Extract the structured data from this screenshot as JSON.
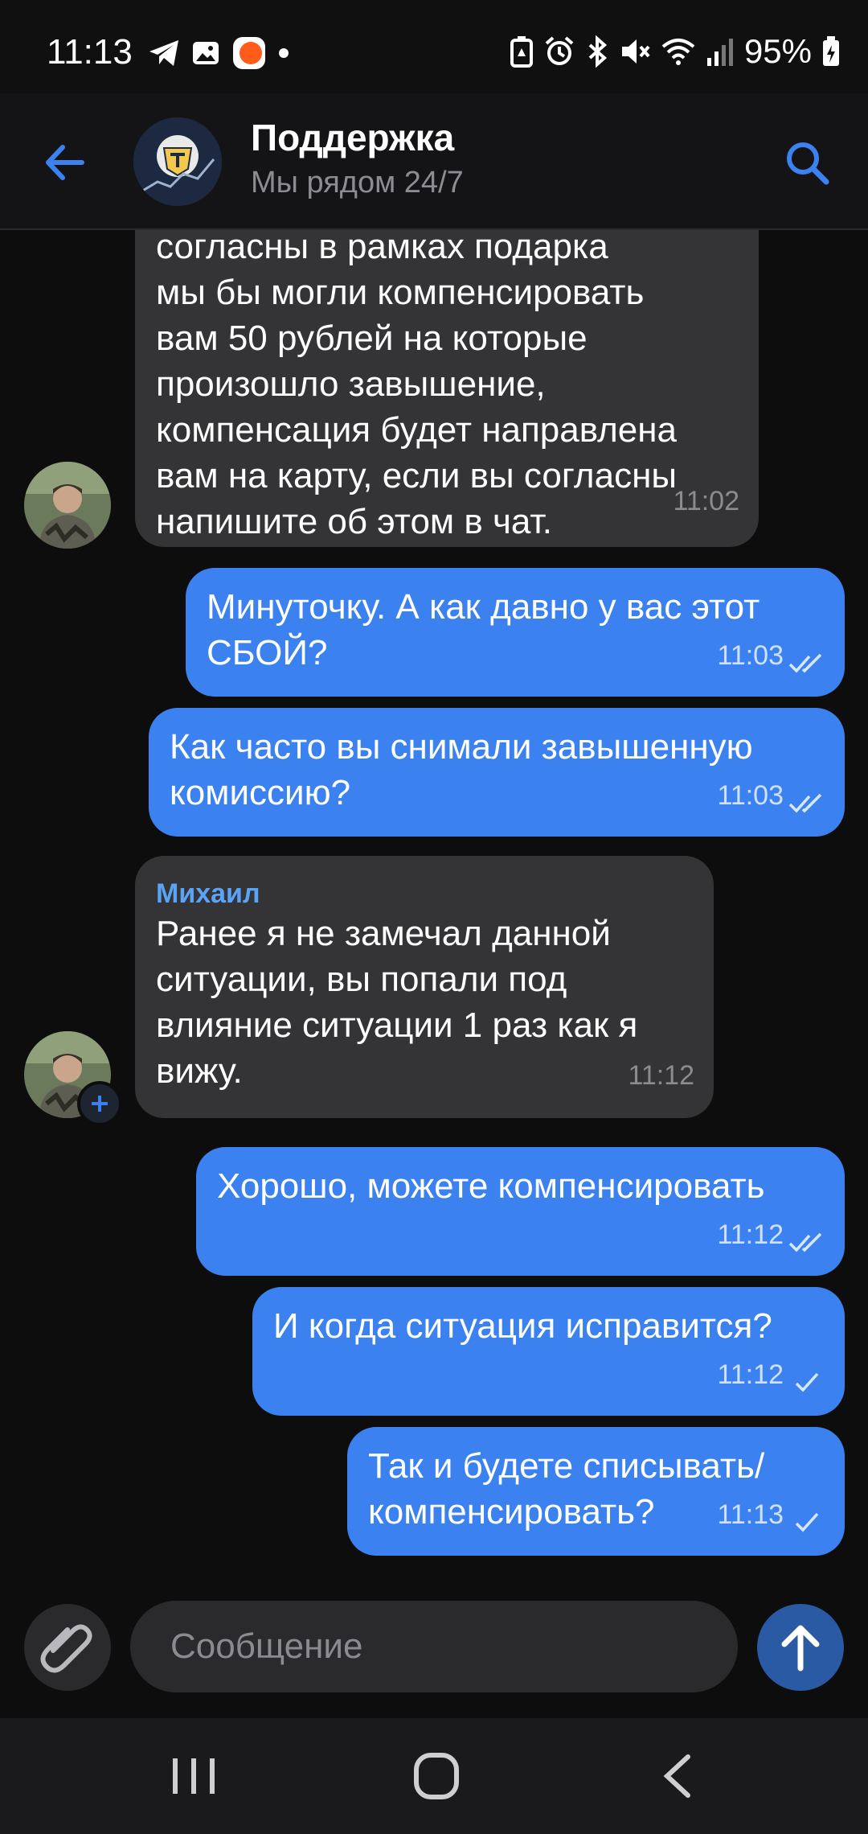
{
  "status_bar": {
    "time": "11:13",
    "battery": "95%",
    "left_icons": [
      "telegram-icon",
      "gallery-icon",
      "app-notification-icon",
      "dot-icon"
    ],
    "right_icons": [
      "battery-saver-icon",
      "alarm-icon",
      "bluetooth-icon",
      "mute-icon",
      "wifi-icon",
      "signal-icon",
      "battery-icon"
    ]
  },
  "header": {
    "title": "Поддержка",
    "subtitle": "Мы рядом 24/7"
  },
  "messages": [
    {
      "dir": "in",
      "text": "согласны в рамках подарка\nмы бы могли компенсировать\nвам 50 рублей на которые\nпроизошло завышение,\nкомпенсация будет направлена\nвам на карту, если вы согласны\nнапишите об этом в чат.",
      "time": "11:02"
    },
    {
      "dir": "out",
      "text": "Минуточку. А как давно у вас этот\nСБОЙ?",
      "time": "11:03",
      "status": "read"
    },
    {
      "dir": "out",
      "text": "Как часто вы снимали завышенную\nкомиссию?",
      "time": "11:03",
      "status": "read"
    },
    {
      "dir": "in",
      "sender": "Михаил",
      "text": "Ранее я не замечал данной\nситуации, вы попали под\nвлияние ситуации 1 раз как я\nвижу.",
      "time": "11:12"
    },
    {
      "dir": "out",
      "text": "Хорошо, можете компенсировать",
      "time": "11:12",
      "status": "read"
    },
    {
      "dir": "out",
      "text": "И когда ситуация исправится?",
      "time": "11:12",
      "status": "sent"
    },
    {
      "dir": "out",
      "text": "Так и будете списывать/\nкомпенсировать?",
      "time": "11:13",
      "status": "sent"
    }
  ],
  "composer": {
    "placeholder": "Сообщение"
  },
  "colors": {
    "outgoing_bubble": "#3b82f0",
    "incoming_bubble": "#343436",
    "accent": "#5aa4f6",
    "background": "#0d0d0e"
  }
}
